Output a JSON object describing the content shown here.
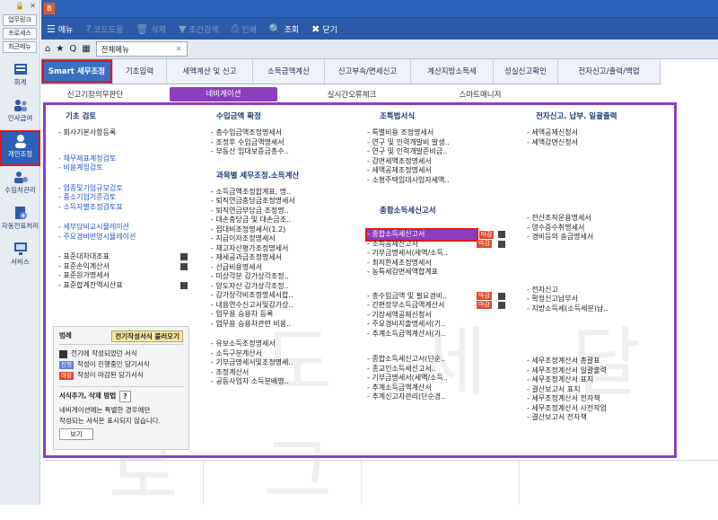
{
  "left_rail": {
    "controls": [
      "🔒",
      "✕"
    ],
    "buttons": [
      "업무링크",
      "프로세스",
      "최근메뉴"
    ],
    "nav": [
      {
        "label": "회계",
        "icon": "ledger-icon"
      },
      {
        "label": "인사급여",
        "icon": "people-icon"
      },
      {
        "label": "개인조정",
        "icon": "person-icon",
        "active": true
      },
      {
        "label": "수임처관리",
        "icon": "client-icon"
      },
      {
        "label": "자동전표처리",
        "icon": "gear-doc-icon"
      },
      {
        "label": "서비스",
        "icon": "monitor-icon"
      }
    ]
  },
  "titlebar": {
    "app_icon": "B"
  },
  "toolbar": {
    "items": [
      {
        "label": "메뉴",
        "icon": "☰",
        "enabled": true
      },
      {
        "label": "코드도움",
        "icon": "?",
        "enabled": false
      },
      {
        "label": "삭제",
        "icon": "🗑",
        "enabled": false
      },
      {
        "label": "조건검색",
        "icon": "▼",
        "enabled": false
      },
      {
        "label": "인쇄",
        "icon": "⎙",
        "enabled": false
      },
      {
        "label": "조회",
        "icon": "🔍",
        "enabled": true
      },
      {
        "label": "닫기",
        "icon": "✖",
        "enabled": true
      }
    ]
  },
  "tabstrip": {
    "icons": [
      "⌂",
      "★",
      "Q",
      "▦"
    ],
    "current_tab": "전체메뉴",
    "close": "✕"
  },
  "category_tabs": [
    "Smart 세무조정",
    "기초입력",
    "세액계산 및 신고",
    "소득금액계산",
    "신고부속/면세신고",
    "계산지방소득세",
    "성실신고확인",
    "전자신고/출력/백업"
  ],
  "sub_tabs": [
    "신고기장의무판단",
    "네비게이션",
    "실시간오류체크",
    "스마트매니저"
  ],
  "col1": {
    "title": "기초 검토",
    "items": [
      "회사기본사항등록"
    ],
    "group2": [
      "재무제표계정검토",
      "비용계정검토"
    ],
    "group3": [
      "업종및기업규모검토",
      "중소기업기준검토",
      "소득자별조정검토표"
    ],
    "group4": [
      "세부담비교시뮬레이션",
      "주요경비반영시뮬레이션"
    ],
    "group5": [
      "표준대차대조표",
      "표준손익계산서",
      "표준원가명세서",
      "표준합계잔액시산표"
    ]
  },
  "legend": {
    "title": "범례",
    "load_button": "전기작성서식 불러오기",
    "rows": [
      "전기에 작성되었던 서식",
      "작성이 진행중인 당기서식",
      "작성이 마감된 당기서식"
    ],
    "badge_progress": "진행",
    "badge_done": "마감",
    "section2": "서식추가, 삭제 방법",
    "help_button": "?",
    "desc1": "네비게이션에는 특별한 경우에만",
    "desc2": "작성되는 서식은 표시되지 않습니다.",
    "view_button": "보기"
  },
  "col2": {
    "title": "수입금액 확정",
    "items": [
      "총수입금액조정명세서",
      "조정후 수입금액명세서",
      "부동산 임대보증금총수.."
    ],
    "title2": "과목별 세무조정.소득계산",
    "items2": [
      "소득금액조정합계표, 명..",
      "퇴직연금충당금조정명세서",
      "퇴직연금부담금 조정명..",
      "대손충당금 및 대손금조..",
      "접대비조정명세서(1.2)",
      "지급이자조정명세서",
      "재고자산평가조정명세서",
      "재세공과금조정명세서",
      "선급비용명세서",
      "미상각분 감가상각조정..",
      "양도자산 감가상각조정..",
      "감가상각비조정명세서합..",
      "내용연수신고서및감가상..",
      "업무용 승용차 등록",
      "업무용 승용차관련 비용.."
    ],
    "items3": [
      "유보소득조정명세서",
      "소득구분계산서",
      "기부금명세서및조정명세..",
      "조정계산서",
      "공동사업자 소득분배명.."
    ]
  },
  "col3": {
    "title": "조특법서식",
    "items": [
      "특별비용 조정명세서",
      "연구 및 인력개발비 발생..",
      "연구 및 인력개발준비금..",
      "감면세액조정명세서",
      "세액공제조정명세서",
      "소형주택임대사업자세액.."
    ],
    "title2": "종합소득세신고서",
    "items2": [
      "종합소득세신고서",
      "소득공제신고서",
      "기부금명세서(세액/소득..",
      "최저한세조정명세서",
      "농특세감면세액합계표"
    ],
    "items3": [
      "총수입금액 및 필요경비..",
      "간편장부소득금액계산서",
      "기장세액공제신청서",
      "주요경비지출명세서(기..",
      "추계소득금액계산서(기.."
    ],
    "items4": [
      "종합소득세신고서(단순..",
      "종교인소득세신고서..",
      "기부금명세서(세액/소득..",
      "추계소득금액계산서",
      "추계신고자관리(단순경.."
    ]
  },
  "col4": {
    "title": "전자신고. 납부. 일괄출력",
    "items": [
      "세액공제신청서",
      "세액감면신청서"
    ],
    "items2": [
      "전산조직운용명세서",
      "영수증수취명세서",
      "경비등의 송금명세서"
    ],
    "items3": [
      "전자신고",
      "확정신고납부서",
      "지방소득세(소득세분)납.."
    ],
    "items4": [
      "세무조정계산서 총괄표",
      "세무조정계산서 일괄출력",
      "세무조정계산서 표지",
      "결산보고서 표지",
      "세무조정계산서 전자책",
      "세무조정계산서 사전작업",
      "결산보고서 전자책"
    ]
  },
  "watermark": "나 도 세 달 로 그",
  "colors": {
    "accent": "#8a3fbf",
    "brand": "#2c5aa8",
    "highlight": "#e01818"
  }
}
